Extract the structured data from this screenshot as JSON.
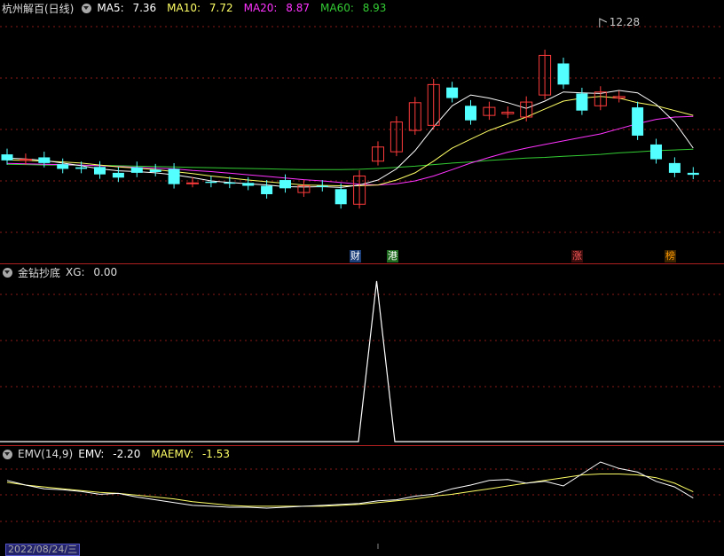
{
  "main": {
    "title": "杭州解百(日线)",
    "ma5_label": "MA5:",
    "ma5_value": "7.36",
    "ma10_label": "MA10:",
    "ma10_value": "7.72",
    "ma20_label": "MA20:",
    "ma20_value": "8.87",
    "ma60_label": "MA60:",
    "ma60_value": "8.93",
    "high_marker": "12.28",
    "tags": [
      {
        "text": "财",
        "color": "#ffffff",
        "bg": "#1c3f7a"
      },
      {
        "text": "港",
        "color": "#ffffff",
        "bg": "#1f6b1f"
      },
      {
        "text": "涨",
        "color": "#ff5a5a",
        "bg": "#3a0c0c"
      },
      {
        "text": "榜",
        "color": "#ff9900",
        "bg": "#3a2400"
      }
    ]
  },
  "ind1": {
    "name": "金钻抄底",
    "xg_label": "XG:",
    "xg_value": "0.00"
  },
  "ind2": {
    "name": "EMV(14,9)",
    "emv_label": "EMV:",
    "emv_value": "-2.20",
    "maemv_label": "MAEMV:",
    "maemv_value": "-1.53"
  },
  "footer": {
    "date": "2022/08/24/三"
  },
  "colors": {
    "up": "#ff3b3b",
    "down": "#54ffff",
    "ma5": "#ffffff",
    "ma10": "#ffff66",
    "ma20": "#ff33ff",
    "ma60": "#33cc33",
    "grid": "#8b1a1a"
  },
  "chart_data": [
    {
      "type": "candlestick",
      "series": "K-line",
      "scale": "log",
      "candles": [
        {
          "o": 7.78,
          "c": 7.62
        },
        {
          "o": 7.62,
          "c": 7.65
        },
        {
          "o": 7.7,
          "c": 7.55
        },
        {
          "o": 7.52,
          "c": 7.4
        },
        {
          "o": 7.44,
          "c": 7.4
        },
        {
          "o": 7.45,
          "c": 7.26
        },
        {
          "o": 7.3,
          "c": 7.18
        },
        {
          "o": 7.44,
          "c": 7.3
        },
        {
          "o": 7.38,
          "c": 7.32
        },
        {
          "o": 7.4,
          "c": 7.02
        },
        {
          "o": 7.05,
          "c": 7.05
        },
        {
          "o": 7.08,
          "c": 7.05
        },
        {
          "o": 7.06,
          "c": 7.03
        },
        {
          "o": 7.05,
          "c": 6.98
        },
        {
          "o": 6.98,
          "c": 6.78
        },
        {
          "o": 7.12,
          "c": 6.92
        },
        {
          "o": 6.82,
          "c": 6.98
        },
        {
          "o": 6.98,
          "c": 6.95
        },
        {
          "o": 6.9,
          "c": 6.55
        },
        {
          "o": 6.55,
          "c": 7.22
        },
        {
          "o": 7.6,
          "c": 7.98
        },
        {
          "o": 7.85,
          "c": 8.7
        },
        {
          "o": 8.45,
          "c": 9.3
        },
        {
          "o": 8.6,
          "c": 9.9
        },
        {
          "o": 9.8,
          "c": 9.45
        },
        {
          "o": 9.2,
          "c": 8.75
        },
        {
          "o": 8.9,
          "c": 9.15
        },
        {
          "o": 8.95,
          "c": 9.0
        },
        {
          "o": 8.85,
          "c": 9.32
        },
        {
          "o": 9.55,
          "c": 10.95
        },
        {
          "o": 10.65,
          "c": 9.9
        },
        {
          "o": 9.6,
          "c": 9.05
        },
        {
          "o": 9.2,
          "c": 9.65
        },
        {
          "o": 9.45,
          "c": 9.5
        },
        {
          "o": 9.15,
          "c": 8.3
        },
        {
          "o": 8.05,
          "c": 7.65
        },
        {
          "o": 7.55,
          "c": 7.3
        },
        {
          "o": 7.3,
          "c": 7.25
        }
      ],
      "ma5": [
        7.68,
        7.66,
        7.62,
        7.55,
        7.48,
        7.4,
        7.35,
        7.33,
        7.3,
        7.25,
        7.18,
        7.1,
        7.06,
        7.03,
        7.0,
        6.96,
        6.95,
        6.96,
        6.94,
        7.0,
        7.12,
        7.4,
        7.88,
        8.55,
        9.2,
        9.55,
        9.45,
        9.3,
        9.12,
        9.35,
        9.65,
        9.62,
        9.6,
        9.7,
        9.62,
        9.25,
        8.7,
        7.95
      ],
      "ma10": [
        7.63,
        7.62,
        7.6,
        7.58,
        7.55,
        7.5,
        7.45,
        7.42,
        7.38,
        7.33,
        7.28,
        7.22,
        7.17,
        7.12,
        7.08,
        7.04,
        7.0,
        6.99,
        6.98,
        6.98,
        7.0,
        7.12,
        7.3,
        7.6,
        7.95,
        8.2,
        8.45,
        8.65,
        8.85,
        9.1,
        9.35,
        9.45,
        9.5,
        9.45,
        9.3,
        9.2,
        9.05,
        8.9
      ],
      "ma20": [
        7.54,
        7.53,
        7.52,
        7.51,
        7.5,
        7.48,
        7.46,
        7.44,
        7.42,
        7.4,
        7.36,
        7.33,
        7.29,
        7.25,
        7.21,
        7.17,
        7.13,
        7.1,
        7.06,
        7.02,
        7.0,
        7.03,
        7.1,
        7.22,
        7.38,
        7.55,
        7.7,
        7.84,
        7.95,
        8.05,
        8.15,
        8.25,
        8.35,
        8.5,
        8.65,
        8.78,
        8.85,
        8.87
      ],
      "ma60": [
        7.52,
        7.51,
        7.5,
        7.5,
        7.49,
        7.49,
        7.48,
        7.47,
        7.46,
        7.45,
        7.44,
        7.43,
        7.42,
        7.41,
        7.4,
        7.39,
        7.38,
        7.38,
        7.38,
        7.39,
        7.41,
        7.44,
        7.47,
        7.51,
        7.55,
        7.58,
        7.62,
        7.65,
        7.68,
        7.7,
        7.73,
        7.75,
        7.78,
        7.82,
        7.85,
        7.88,
        7.9,
        7.92
      ]
    },
    {
      "type": "line",
      "series": "XG",
      "x_index": [
        0,
        19,
        20,
        21,
        37
      ],
      "values": [
        0,
        0,
        1,
        0,
        0
      ]
    },
    {
      "type": "line",
      "series": "EMV / MAEMV",
      "emv": [
        -0.3,
        -0.8,
        -1.2,
        -1.3,
        -1.5,
        -1.8,
        -1.7,
        -2.1,
        -2.4,
        -2.7,
        -3.0,
        -3.1,
        -3.2,
        -3.2,
        -3.3,
        -3.2,
        -3.1,
        -3.0,
        -2.9,
        -2.8,
        -2.5,
        -2.4,
        -2.0,
        -1.8,
        -1.2,
        -0.8,
        -0.3,
        -0.2,
        -0.6,
        -0.4,
        -0.9,
        0.4,
        1.7,
        1.0,
        0.6,
        -0.4,
        -1.0,
        -2.2
      ],
      "maemv": [
        -0.5,
        -0.8,
        -1.0,
        -1.2,
        -1.4,
        -1.6,
        -1.7,
        -1.9,
        -2.1,
        -2.3,
        -2.6,
        -2.8,
        -3.0,
        -3.1,
        -3.1,
        -3.1,
        -3.1,
        -3.1,
        -3.0,
        -2.9,
        -2.7,
        -2.5,
        -2.3,
        -2.0,
        -1.8,
        -1.5,
        -1.2,
        -0.9,
        -0.6,
        -0.3,
        0.0,
        0.3,
        0.4,
        0.4,
        0.3,
        0.0,
        -0.6,
        -1.53
      ]
    }
  ]
}
